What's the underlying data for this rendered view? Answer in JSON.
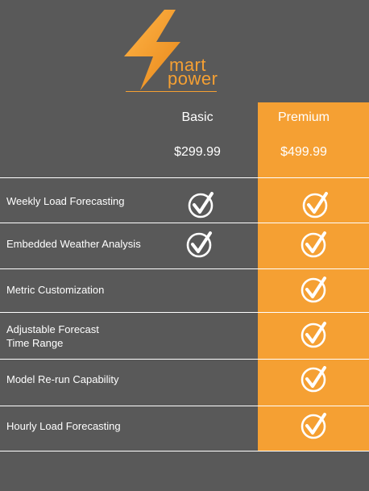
{
  "brand": {
    "logo_text_line1": "mart",
    "logo_text_line2": "power",
    "accent_color": "#f5a033",
    "background_color": "#595959"
  },
  "plans": [
    {
      "name": "Basic",
      "price": "$299.99"
    },
    {
      "name": "Premium",
      "price": "$499.99"
    }
  ],
  "features": [
    {
      "label": "Weekly Load Forecasting",
      "basic": true,
      "premium": true
    },
    {
      "label": "Embedded Weather Analysis",
      "basic": true,
      "premium": true
    },
    {
      "label": "Metric Customization",
      "basic": false,
      "premium": true
    },
    {
      "label": " Adjustable Forecast\nTime Range",
      "basic": false,
      "premium": true
    },
    {
      "label": "Model Re-run Capability",
      "basic": false,
      "premium": true
    },
    {
      "label": "Hourly Load Forecasting",
      "basic": false,
      "premium": true
    }
  ],
  "icons": {
    "logo": "lightning-bolt-icon",
    "included": "check-circle-icon"
  }
}
